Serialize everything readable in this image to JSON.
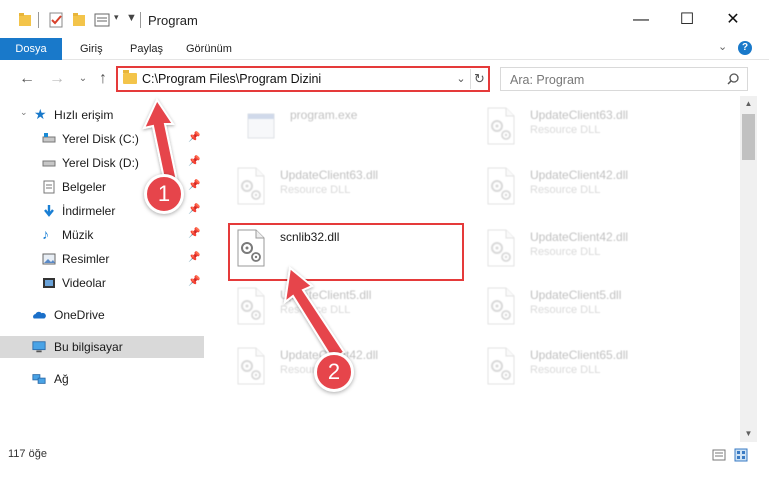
{
  "window": {
    "title": "Program",
    "controls": {
      "minimize": "—",
      "maximize": "☐",
      "close": "✕"
    }
  },
  "ribbon": {
    "tabs": [
      {
        "label": "Dosya",
        "active": true
      },
      {
        "label": "Giriş"
      },
      {
        "label": "Paylaş"
      },
      {
        "label": "Görünüm"
      }
    ]
  },
  "address": {
    "path": "C:\\Program Files\\Program Dizini",
    "search_placeholder": "Ara: Program"
  },
  "sidebar": {
    "quick_access": "Hızlı erişim",
    "items": [
      {
        "label": "Yerel Disk (C:)",
        "icon": "drive-icon",
        "pinned": true
      },
      {
        "label": "Yerel Disk (D:)",
        "icon": "drive-icon",
        "pinned": true
      },
      {
        "label": "Belgeler",
        "icon": "documents-icon",
        "pinned": true
      },
      {
        "label": "İndirmeler",
        "icon": "downloads-icon",
        "pinned": true
      },
      {
        "label": "Müzik",
        "icon": "music-icon",
        "pinned": true
      },
      {
        "label": "Resimler",
        "icon": "pictures-icon",
        "pinned": true
      },
      {
        "label": "Videolar",
        "icon": "videos-icon",
        "pinned": true
      }
    ],
    "onedrive": "OneDrive",
    "this_pc": "Bu bilgisayar",
    "network": "Ağ"
  },
  "files": [
    {
      "name": "program.exe",
      "type": "",
      "faded": true
    },
    {
      "name": "UpdateClient63.dll",
      "type": "Resource DLL",
      "faded": true
    },
    {
      "name": "UpdateClient63.dll",
      "type": "Resource DLL",
      "faded": true
    },
    {
      "name": "UpdateClient42.dll",
      "type": "Resource DLL",
      "faded": true
    },
    {
      "name": "scnlib32.dll",
      "type": "",
      "faded": false
    },
    {
      "name": "UpdateClient42.dll",
      "type": "Resource DLL",
      "faded": true
    },
    {
      "name": "UpdateClient5.dll",
      "type": "Resource DLL",
      "faded": true
    },
    {
      "name": "UpdateClient5.dll",
      "type": "Resource DLL",
      "faded": true
    },
    {
      "name": "UpdateClient42.dll",
      "type": "Resource DLL",
      "faded": true
    },
    {
      "name": "UpdateClient65.dll",
      "type": "Resource DLL",
      "faded": true
    }
  ],
  "status": {
    "item_count": "117 öğe"
  },
  "callouts": {
    "one": "1",
    "two": "2"
  },
  "colors": {
    "accent": "#1979ca",
    "highlight": "#e53a3a",
    "badge": "#e6454b"
  }
}
